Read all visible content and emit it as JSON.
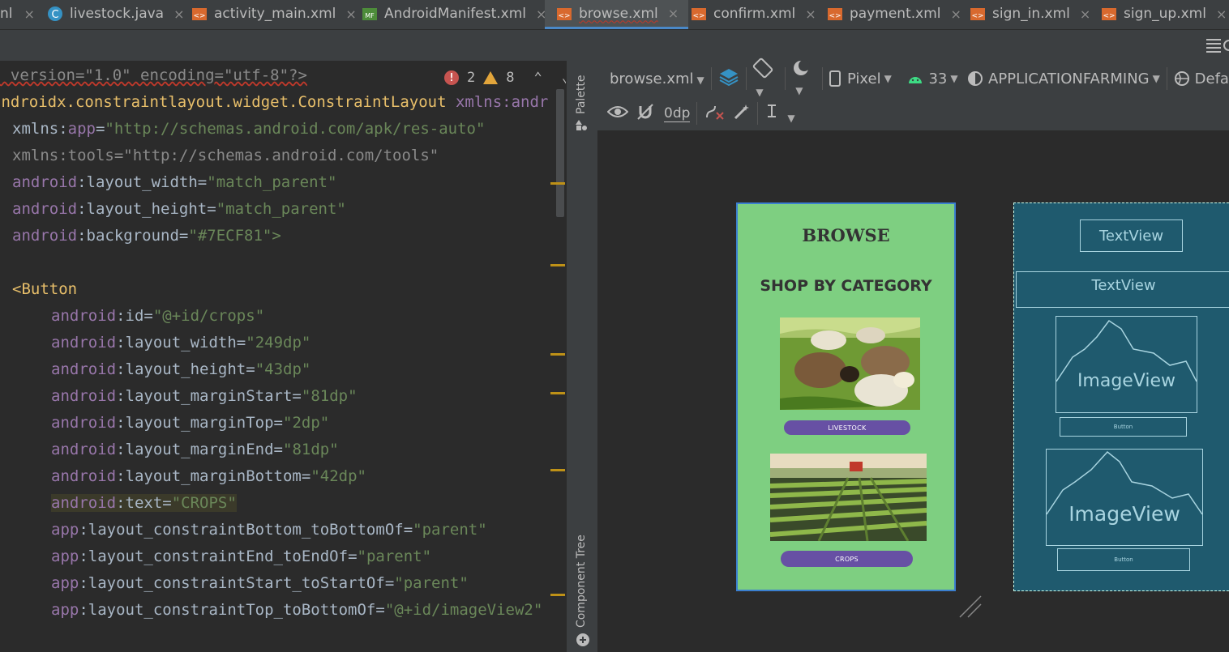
{
  "tabs": [
    {
      "label": "nl",
      "icon": "none",
      "active": false
    },
    {
      "label": "livestock.java",
      "icon": "java-class-icon",
      "active": false
    },
    {
      "label": "activity_main.xml",
      "icon": "xml-layout-icon",
      "active": false
    },
    {
      "label": "AndroidManifest.xml",
      "icon": "manifest-icon",
      "active": false
    },
    {
      "label": "browse.xml",
      "icon": "xml-layout-icon",
      "active": true
    },
    {
      "label": "confirm.xml",
      "icon": "xml-layout-icon",
      "active": false
    },
    {
      "label": "payment.xml",
      "icon": "xml-layout-icon",
      "active": false
    },
    {
      "label": "sign_in.xml",
      "icon": "xml-layout-icon",
      "active": false
    },
    {
      "label": "sign_up.xml",
      "icon": "xml-layout-icon",
      "active": false
    }
  ],
  "close_glyph": "×",
  "inspections": {
    "errors": "2",
    "warnings": "8"
  },
  "code": {
    "xml_decl": "l version=\"1.0\" encoding=\"utf-8\"?>",
    "root_tag": "androidx.constraintlayout.widget.ConstraintLayout",
    "root_attr": "xmlns:andr",
    "lines": [
      {
        "ns": "xmlns:",
        "attr": "app",
        "eq": "=",
        "val": "\"http://schemas.android.com/apk/res-auto\""
      },
      {
        "ns": "",
        "attr": "xmlns:tools",
        "eq": "=",
        "val": "\"http://schemas.android.com/tools\""
      },
      {
        "ns": "android",
        "attr": ":layout_width",
        "eq": "=",
        "val": "\"match_parent\""
      },
      {
        "ns": "android",
        "attr": ":layout_height",
        "eq": "=",
        "val": "\"match_parent\""
      },
      {
        "ns": "android",
        "attr": ":background",
        "eq": "=",
        "val": "\"#7ECF81\">"
      }
    ],
    "button_tag": "<Button",
    "button_attrs": [
      {
        "ns": "android",
        "attr": ":id",
        "val": "\"@+id/crops\""
      },
      {
        "ns": "android",
        "attr": ":layout_width",
        "val": "\"249dp\""
      },
      {
        "ns": "android",
        "attr": ":layout_height",
        "val": "\"43dp\""
      },
      {
        "ns": "android",
        "attr": ":layout_marginStart",
        "val": "\"81dp\""
      },
      {
        "ns": "android",
        "attr": ":layout_marginTop",
        "val": "\"2dp\""
      },
      {
        "ns": "android",
        "attr": ":layout_marginEnd",
        "val": "\"81dp\""
      },
      {
        "ns": "android",
        "attr": ":layout_marginBottom",
        "val": "\"42dp\""
      },
      {
        "ns": "android",
        "attr": ":text",
        "val": "\"CROPS\""
      },
      {
        "ns": "app",
        "attr": ":layout_constraintBottom_toBottomOf",
        "val": "\"parent\""
      },
      {
        "ns": "app",
        "attr": ":layout_constraintEnd_toEndOf",
        "val": "\"parent\""
      },
      {
        "ns": "app",
        "attr": ":layout_constraintStart_toStartOf",
        "val": "\"parent\""
      },
      {
        "ns": "app",
        "attr": ":layout_constraintTop_toBottomOf",
        "val": "\"@+id/imageView2\""
      }
    ]
  },
  "side_strip": {
    "palette": "Palette",
    "component_tree": "Component Tree"
  },
  "design_toolbar": {
    "file": "browse.xml",
    "device": "Pixel",
    "api": "33",
    "theme": "APPLICATIONFARMING",
    "locale": "Defa",
    "margin": "0dp"
  },
  "phone": {
    "title": "BROWSE",
    "subtitle": "SHOP BY CATEGORY",
    "button1": "LIVESTOCK",
    "button2": "CROPS",
    "background": "#7ECF81",
    "button_color": "#6750A4"
  },
  "blueprint": {
    "textview1": "TextView",
    "textview2": "TextView",
    "imageview1": "ImageView",
    "imageview2": "ImageView",
    "button1": "Button",
    "button2": "Button"
  }
}
